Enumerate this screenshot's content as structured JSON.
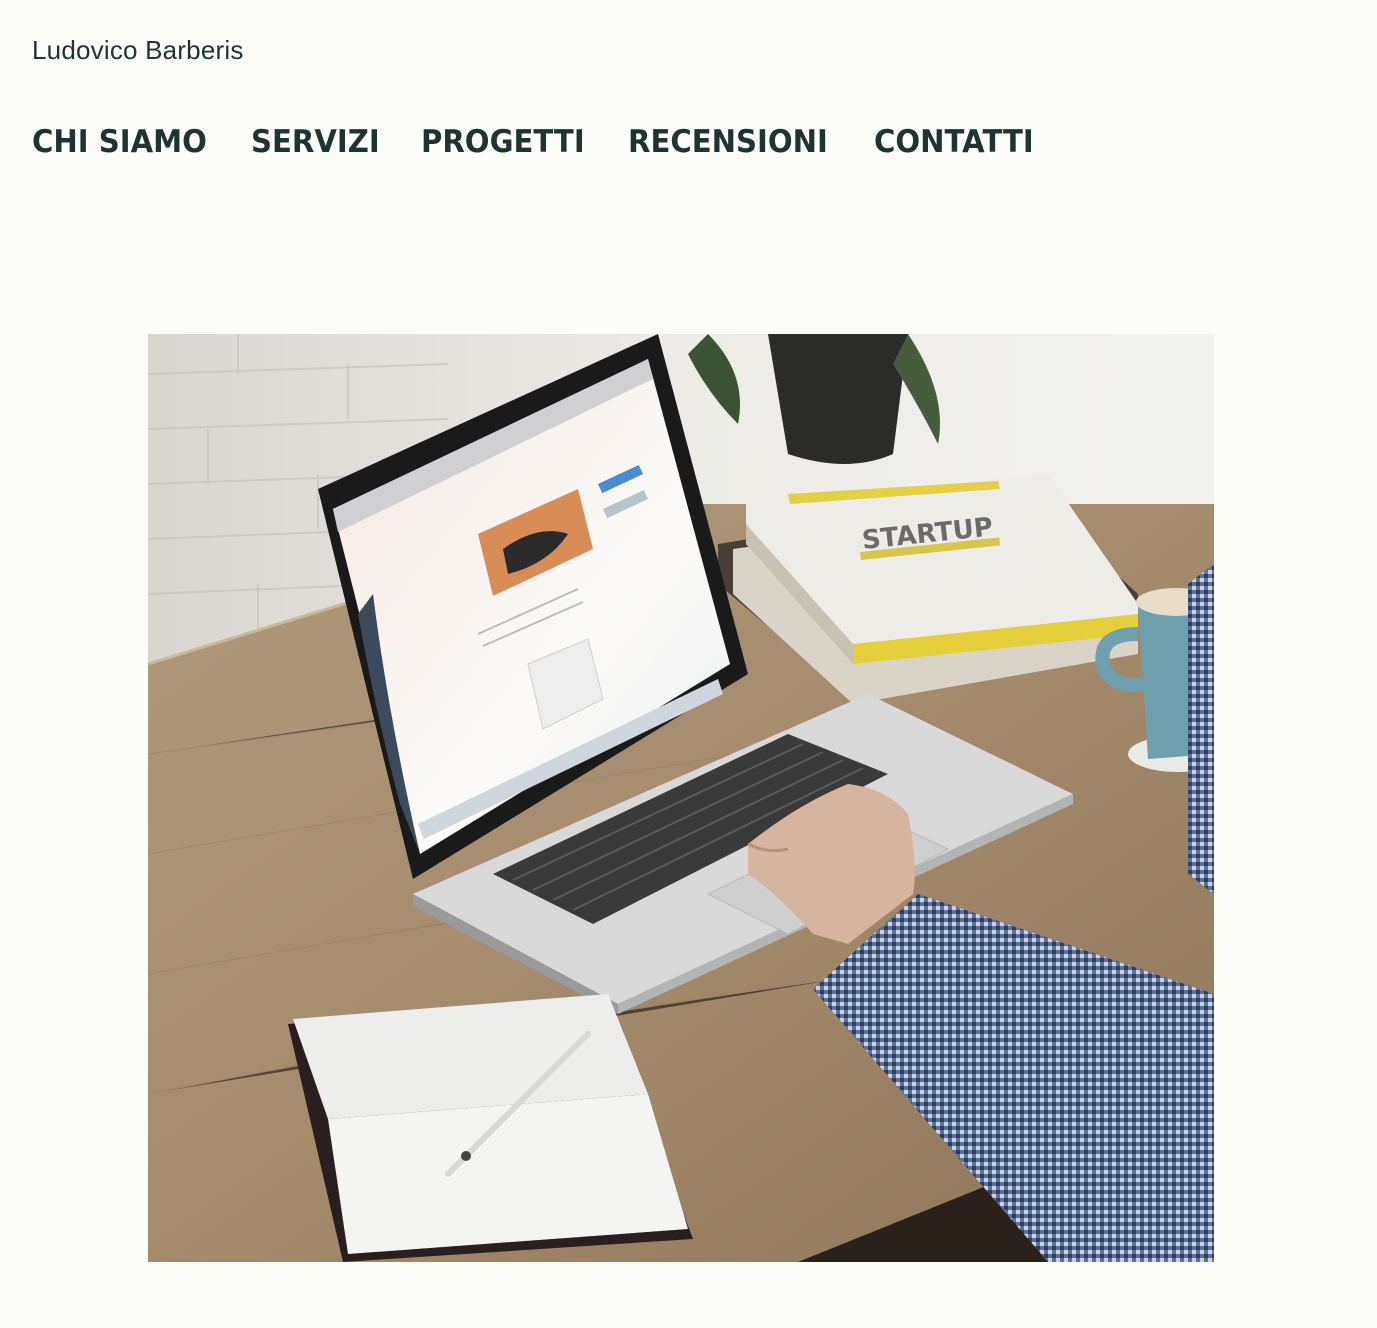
{
  "header": {
    "site_title": "Ludovico Barberis"
  },
  "nav": {
    "items": [
      {
        "label": "CHI SIAMO"
      },
      {
        "label": "SERVIZI"
      },
      {
        "label": "PROGETTI"
      },
      {
        "label": "RECENSIONI"
      },
      {
        "label": "CONTATTI"
      }
    ]
  },
  "hero": {
    "image_subject": "laptop-on-desk-photo",
    "book_cover_text": "STARTUP"
  },
  "colors": {
    "background": "#fcfdf8",
    "text": "#1f3333"
  }
}
